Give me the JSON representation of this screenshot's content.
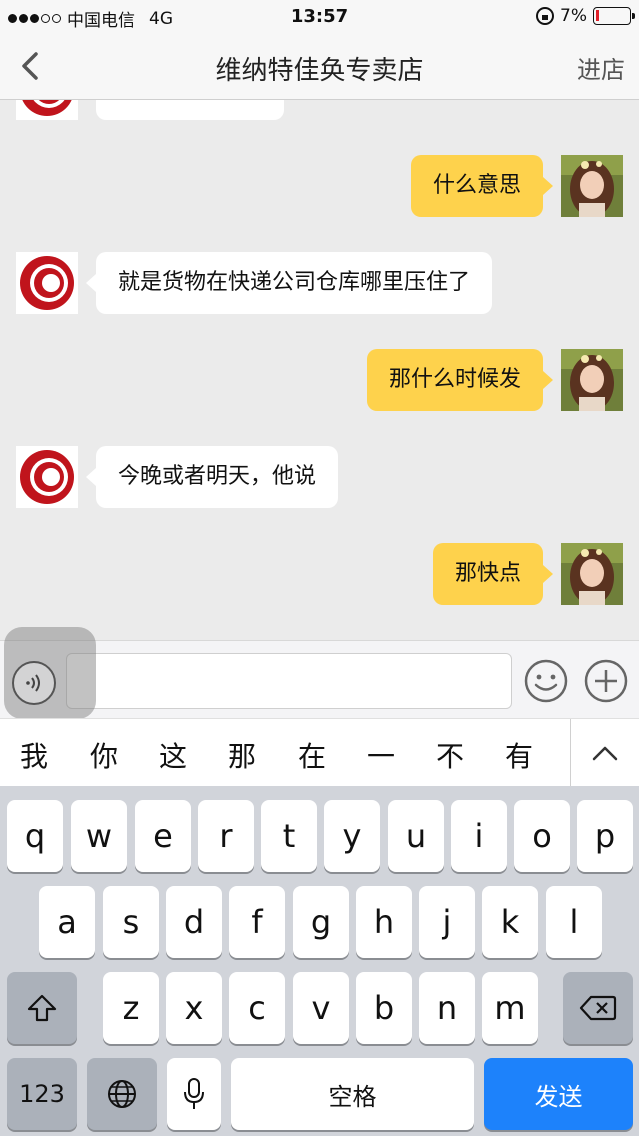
{
  "status_bar": {
    "carrier": "中国电信",
    "network": "4G",
    "time": "13:57",
    "battery": "7%",
    "battery_level": 0.07
  },
  "nav": {
    "title": "维纳特佳奂专卖店",
    "right_action": "进店"
  },
  "messages": [
    {
      "side": "in",
      "text": ""
    },
    {
      "side": "out",
      "text": "什么意思"
    },
    {
      "side": "in",
      "text": "就是货物在快递公司仓库哪里压住了"
    },
    {
      "side": "out",
      "text": "那什么时候发"
    },
    {
      "side": "in",
      "text": "今晚或者明天，他说"
    },
    {
      "side": "out",
      "text": "那快点"
    }
  ],
  "input": {
    "value": "",
    "placeholder": ""
  },
  "candidates": [
    "我",
    "你",
    "这",
    "那",
    "在",
    "一",
    "不",
    "有"
  ],
  "keyboard": {
    "row1": [
      "q",
      "w",
      "e",
      "r",
      "t",
      "y",
      "u",
      "i",
      "o",
      "p"
    ],
    "row2": [
      "a",
      "s",
      "d",
      "f",
      "g",
      "h",
      "j",
      "k",
      "l"
    ],
    "row3": [
      "z",
      "x",
      "c",
      "v",
      "b",
      "n",
      "m"
    ],
    "numbers_key": "123",
    "space_key": "空格",
    "send_key": "发送"
  },
  "colors": {
    "outgoing_bubble": "#fed24c",
    "incoming_bubble": "#ffffff",
    "send_key": "#1d82fb",
    "shop_logo": "#c0141c"
  },
  "icons": {
    "back": "chevron-left-icon",
    "voice": "voice-icon",
    "emoji": "smiley-icon",
    "plus": "plus-circle-icon",
    "expand": "chevron-up-icon",
    "shift": "shift-icon",
    "delete": "backspace-icon",
    "globe": "globe-icon",
    "mic": "microphone-icon"
  }
}
